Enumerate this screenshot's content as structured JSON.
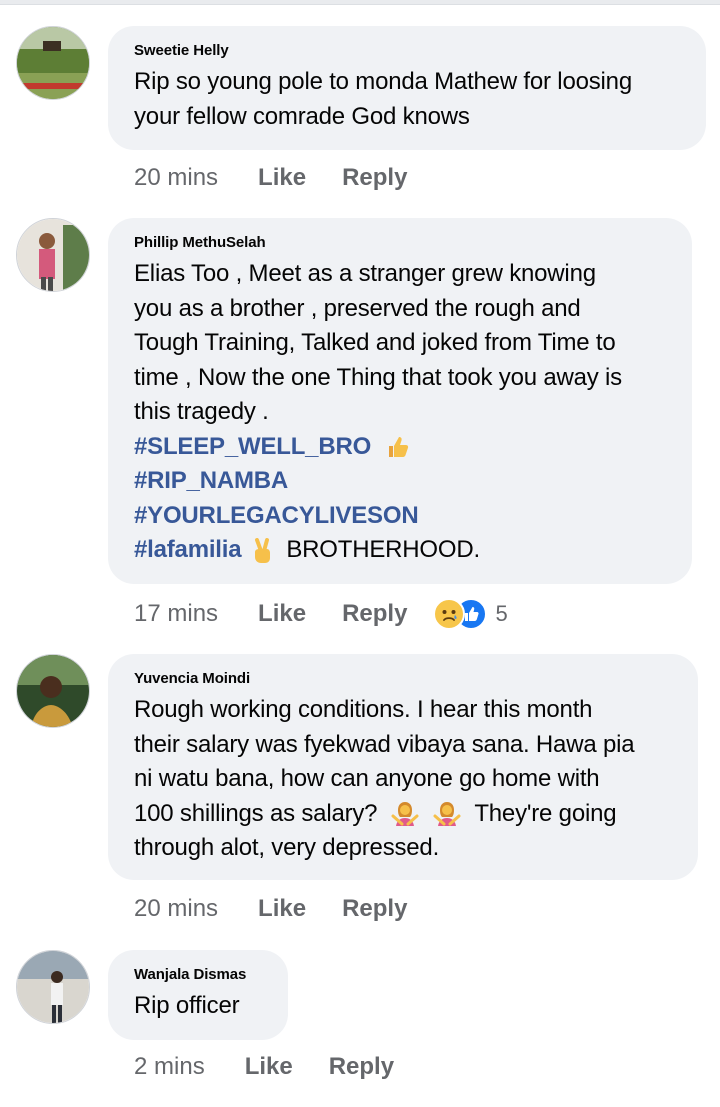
{
  "comments": [
    {
      "author": "Sweetie Helly",
      "lines": [
        "Rip so young pole to monda Mathew for loosing",
        "your fellow comrade God knows"
      ],
      "time": "20 mins",
      "like": "Like",
      "reply": "Reply"
    },
    {
      "author": "Phillip MethuSelah",
      "lines": [
        "Elias Too , Meet as a stranger grew knowing",
        "you as a brother , preserved the rough and",
        "Tough Training, Talked and joked from Time to",
        "time , Now the one Thing that took you away is",
        "this tragedy ."
      ],
      "hashtags": [
        "#SLEEP_WELL_BRO",
        "#RIP_NAMBA",
        "#YOURLEGACYLIVESON",
        "#lafamilia"
      ],
      "tail_text": "BROTHERHOOD.",
      "time": "17 mins",
      "like": "Like",
      "reply": "Reply",
      "reaction_count": "5"
    },
    {
      "author": "Yuvencia Moindi",
      "lines": [
        "Rough working conditions. I hear this month",
        "their salary was fyekwad vibaya sana. Hawa pia",
        "ni watu bana, how can anyone go home with",
        "100 shillings as salary?",
        "through alot, very depressed."
      ],
      "inline_after_emoji": "They're going",
      "time": "20 mins",
      "like": "Like",
      "reply": "Reply"
    },
    {
      "author": "Wanjala Dismas",
      "lines": [
        "Rip officer"
      ],
      "time": "2 mins",
      "like": "Like",
      "reply": "Reply"
    }
  ],
  "colors": {
    "bubble": "#f0f2f5",
    "hashtag": "#385898",
    "meta": "#65676b",
    "like_blue": "#1877f2",
    "sad_yellow": "#f7c64a"
  },
  "icons": {
    "thumbs_up_emoji": "thumbs-up-emoji",
    "victory_hand_emoji": "victory-hand-emoji",
    "woman_gesturing_emoji": "woman-gesturing-no-emoji",
    "sad_reaction": "sad-reaction-icon",
    "like_reaction": "like-reaction-icon"
  }
}
